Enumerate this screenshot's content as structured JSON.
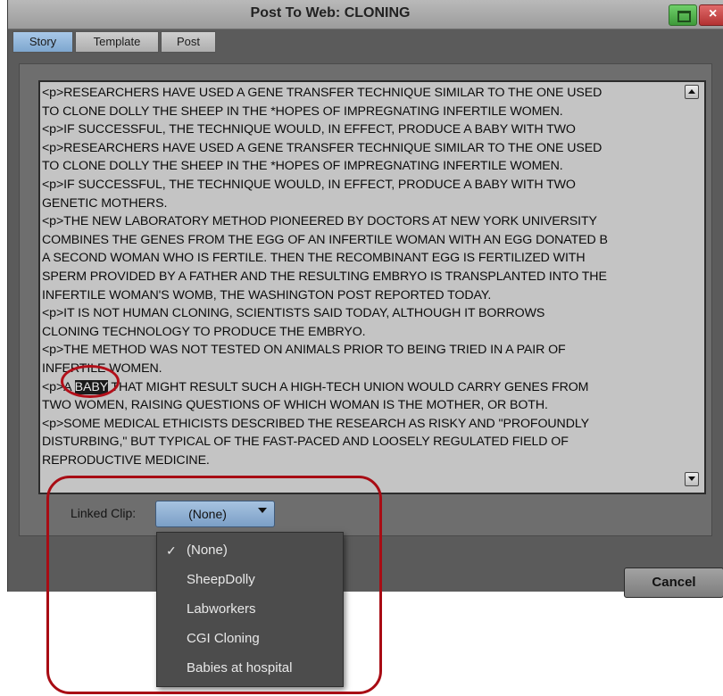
{
  "window": {
    "title": "Post To Web: CLONING"
  },
  "tabs": [
    {
      "label": "Story",
      "active": true
    },
    {
      "label": "Template",
      "active": false
    },
    {
      "label": "Post",
      "active": false
    }
  ],
  "story": {
    "lines": [
      "<p>RESEARCHERS HAVE USED A GENE TRANSFER TECHNIQUE SIMILAR TO THE ONE USED",
      "TO CLONE DOLLY THE SHEEP IN THE *HOPES OF IMPREGNATING INFERTILE WOMEN.",
      "<p>IF SUCCESSFUL, THE TECHNIQUE WOULD, IN EFFECT, PRODUCE A BABY WITH TWO",
      "<p>RESEARCHERS HAVE USED A GENE TRANSFER TECHNIQUE SIMILAR TO THE ONE USED",
      "TO CLONE DOLLY THE SHEEP IN THE *HOPES OF IMPREGNATING INFERTILE WOMEN.",
      "<p>IF SUCCESSFUL, THE TECHNIQUE WOULD, IN EFFECT, PRODUCE A BABY WITH TWO",
      "GENETIC MOTHERS.",
      "<p>THE NEW LABORATORY METHOD PIONEERED BY DOCTORS AT NEW YORK UNIVERSITY",
      "COMBINES THE GENES FROM THE EGG OF AN INFERTILE WOMAN WITH AN EGG DONATED B",
      "A SECOND WOMAN WHO IS FERTILE. THEN THE RECOMBINANT EGG IS FERTILIZED WITH",
      "SPERM PROVIDED BY A FATHER AND THE RESULTING EMBRYO IS TRANSPLANTED INTO THE",
      "INFERTILE WOMAN'S WOMB, THE WASHINGTON POST REPORTED TODAY.",
      "<p>IT IS NOT HUMAN CLONING, SCIENTISTS SAID TODAY, ALTHOUGH IT BORROWS",
      "CLONING TECHNOLOGY TO PRODUCE THE EMBRYO.",
      "<p>THE METHOD WAS NOT TESTED ON ANIMALS PRIOR TO BEING TRIED IN A PAIR OF",
      "INFERTILE WOMEN.",
      "",
      "TWO WOMEN, RAISING QUESTIONS OF WHICH WOMAN IS THE MOTHER, OR BOTH.",
      "<p>SOME MEDICAL ETHICISTS DESCRIBED THE RESEARCH AS RISKY AND \"PROFOUNDLY",
      "DISTURBING,\" BUT TYPICAL OF THE FAST-PACED AND LOOSELY REGULATED FIELD OF",
      "REPRODUCTIVE MEDICINE."
    ],
    "highlight_line": {
      "before": "<p>A ",
      "selected": "BABY",
      "after": " THAT MIGHT RESULT SUCH A HIGH-TECH UNION WOULD CARRY GENES FROM"
    }
  },
  "linked_clip": {
    "label": "Linked Clip:",
    "value": "(None)",
    "options": [
      "(None)",
      "SheepDolly",
      "Labworkers",
      "CGI Cloning",
      "Babies at hospital"
    ],
    "checked": "(None)"
  },
  "buttons": {
    "cancel": "Cancel"
  },
  "annotation": {
    "color": "#a80c14"
  }
}
